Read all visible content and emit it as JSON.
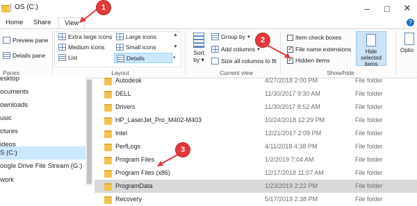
{
  "window": {
    "title": "OS (C:)"
  },
  "tabs": [
    "Home",
    "Share",
    "View"
  ],
  "ribbon": {
    "panes": {
      "preview": "Preview pane",
      "details": "Details pane",
      "group_label": "Panes"
    },
    "layout": {
      "items": [
        "Extra large icons",
        "Large icons",
        "Medium icons",
        "Small icons",
        "List",
        "Details"
      ],
      "selected": "Details",
      "group_label": "Layout"
    },
    "current_view": {
      "sort_line1": "Sort",
      "sort_line2": "by",
      "group_by": "Group by",
      "add_columns": "Add columns",
      "size_all": "Size all columns to fit",
      "group_label": "Current view"
    },
    "show_hide": {
      "item_checkboxes": {
        "label": "Item check boxes",
        "checked": false
      },
      "file_name_extensions": {
        "label": "File name extensions",
        "checked": true
      },
      "hidden_items": {
        "label": "Hidden items",
        "checked": true
      },
      "hide_selected_line1": "Hide selected",
      "hide_selected_line2": "items",
      "group_label": "Show/hide"
    },
    "options": "Optio"
  },
  "nav": {
    "items": [
      "esktop",
      "ocuments",
      "ownloads",
      "usic",
      "ctures",
      "ideos",
      "S (C:)",
      "oogle Drive File Stream (G:)",
      "work"
    ],
    "selected_index": 6
  },
  "files": [
    {
      "name": "Autodesk",
      "date": "4/27/2018 2:00 PM",
      "type": "File folder"
    },
    {
      "name": "DELL",
      "date": "11/30/2017 9:30 AM",
      "type": "File folder"
    },
    {
      "name": "Drivers",
      "date": "11/30/2017 8:52 AM",
      "type": "File folder"
    },
    {
      "name": "HP_LaserJet_Pro_M402-M403",
      "date": "10/24/2018 12:29 PM",
      "type": "File folder"
    },
    {
      "name": "Intel",
      "date": "12/21/2017 2:09 PM",
      "type": "File folder"
    },
    {
      "name": "PerfLogs",
      "date": "4/11/2018 4:38 PM",
      "type": "File folder"
    },
    {
      "name": "Program Files",
      "date": "1/2/2019 7:04 AM",
      "type": "File folder"
    },
    {
      "name": "Program Files (x86)",
      "date": "12/17/2018 11:07 AM",
      "type": "File folder"
    },
    {
      "name": "ProgramData",
      "date": "1/23/2019 2:22 PM",
      "type": "File folder"
    },
    {
      "name": "Recovery",
      "date": "5/17/2019 2:38 PM",
      "type": "File folder"
    }
  ],
  "selected_file_index": 8,
  "annotations": [
    "1",
    "2",
    "3"
  ],
  "colors": {
    "annotation": "#e3393b",
    "selection": "#cce8ff",
    "accent_button": "#cce4f7"
  }
}
